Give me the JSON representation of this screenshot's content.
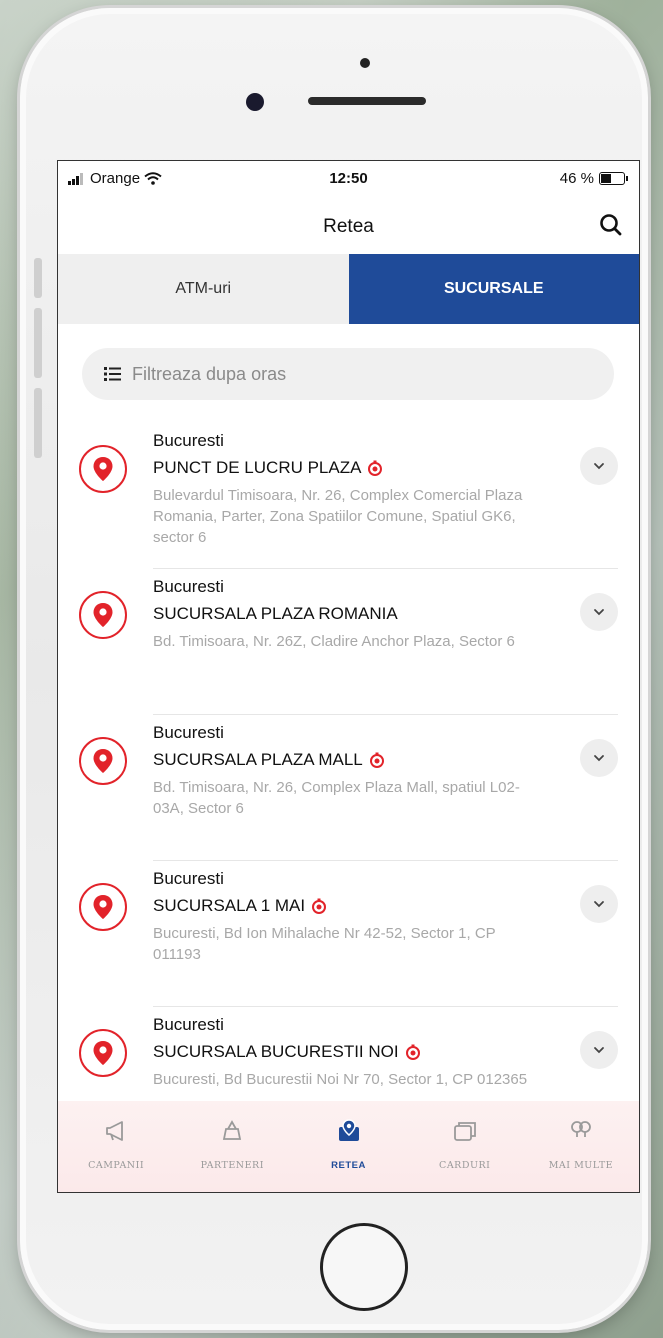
{
  "status_bar": {
    "carrier": "Orange",
    "time": "12:50",
    "battery": "46 %",
    "battery_level": 0.46
  },
  "header": {
    "title": "Retea",
    "search_icon": "search-icon"
  },
  "tabs": [
    {
      "label": "ATM-uri",
      "active": false
    },
    {
      "label": "SUCURSALE",
      "active": true
    }
  ],
  "filter": {
    "placeholder": "Filtreaza dupa oras",
    "icon": "list-icon"
  },
  "branches": [
    {
      "city": "Bucuresti",
      "name": "PUNCT DE LUCRU PLAZA",
      "has_timer": true,
      "address": "Bulevardul Timisoara, Nr. 26, Complex Comercial Plaza Romania, Parter, Zona Spatiilor Comune, Spatiul GK6, sector 6"
    },
    {
      "city": "Bucuresti",
      "name": "SUCURSALA PLAZA ROMANIA",
      "has_timer": false,
      "address": "Bd. Timisoara, Nr. 26Z, Cladire Anchor Plaza, Sector 6"
    },
    {
      "city": "Bucuresti",
      "name": "SUCURSALA PLAZA  MALL",
      "has_timer": true,
      "address": "Bd. Timisoara, Nr. 26, Complex Plaza Mall, spatiul L02-03A, Sector 6"
    },
    {
      "city": "Bucuresti",
      "name": "SUCURSALA 1 MAI",
      "has_timer": true,
      "address": "Bucuresti, Bd Ion Mihalache Nr 42-52, Sector 1, CP 011193"
    },
    {
      "city": "Bucuresti",
      "name": "SUCURSALA BUCURESTII NOI",
      "has_timer": true,
      "address": "Bucuresti, Bd Bucurestii Noi Nr 70, Sector 1, CP 012365"
    }
  ],
  "tab_bar": [
    {
      "label": "CAMPANII",
      "icon": "megaphone-icon",
      "active": false
    },
    {
      "label": "PARTENERI",
      "icon": "shopping-bag-icon",
      "active": false
    },
    {
      "label": "RETEA",
      "icon": "map-pin-icon",
      "active": true
    },
    {
      "label": "CARDURI",
      "icon": "cards-icon",
      "active": false
    },
    {
      "label": "MAI MULTE",
      "icon": "more-icon",
      "active": false
    }
  ],
  "colors": {
    "brand_blue": "#1f4b99",
    "brand_red": "#e2232a"
  }
}
